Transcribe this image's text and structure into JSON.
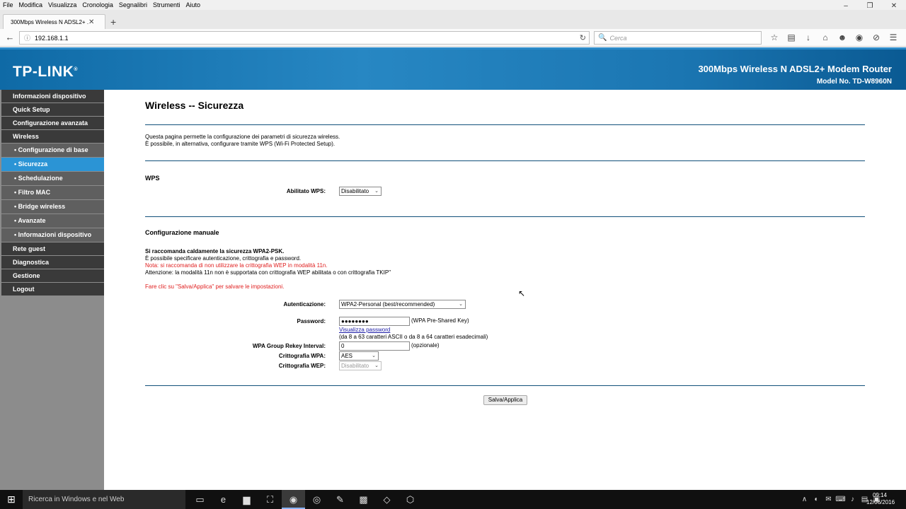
{
  "browser": {
    "menu": [
      "File",
      "Modifica",
      "Visualizza",
      "Cronologia",
      "Segnalibri",
      "Strumenti",
      "Aiuto"
    ],
    "window_controls": [
      "–",
      "❐",
      "✕"
    ],
    "tab_title": "300Mbps Wireless N ADSL2+ ...",
    "tab_close": "✕",
    "new_tab": "+",
    "back": "←",
    "info_icon": "ⓘ",
    "url": "192.168.1.1",
    "reload": "↻",
    "search_placeholder": "Cerca",
    "search_icon": "🔍",
    "toolbar_icons": [
      "☆",
      "▤",
      "↓",
      "⌂",
      "☻",
      "◉",
      "⊘",
      "☰"
    ]
  },
  "router": {
    "logo": "TP-LINK",
    "logo_mark": "®",
    "product": "300Mbps Wireless N ADSL2+ Modem Router",
    "model": "Model No. TD-W8960N",
    "sidebar": [
      {
        "label": "Informazioni dispositivo",
        "sub": false,
        "active": false
      },
      {
        "label": "Quick Setup",
        "sub": false,
        "active": false
      },
      {
        "label": "Configurazione avanzata",
        "sub": false,
        "active": false
      },
      {
        "label": "Wireless",
        "sub": false,
        "active": false
      },
      {
        "label": "• Configurazione di base",
        "sub": true,
        "active": false
      },
      {
        "label": "• Sicurezza",
        "sub": true,
        "active": true
      },
      {
        "label": "• Schedulazione",
        "sub": true,
        "active": false
      },
      {
        "label": "• Filtro MAC",
        "sub": true,
        "active": false
      },
      {
        "label": "• Bridge wireless",
        "sub": true,
        "active": false
      },
      {
        "label": "• Avanzate",
        "sub": true,
        "active": false
      },
      {
        "label": "• Informazioni dispositivo",
        "sub": true,
        "active": false
      },
      {
        "label": "Rete guest",
        "sub": false,
        "active": false
      },
      {
        "label": "Diagnostica",
        "sub": false,
        "active": false
      },
      {
        "label": "Gestione",
        "sub": false,
        "active": false
      },
      {
        "label": "Logout",
        "sub": false,
        "active": false
      }
    ],
    "page_title": "Wireless -- Sicurezza",
    "desc_line1": "Questa pagina permette la configurazione dei parametri di sicurezza wireless.",
    "desc_line2": "È possibile, in alternativa, configurare tramite WPS (Wi-Fi Protected Setup).",
    "wps_heading": "WPS",
    "wps_label": "Abilitato WPS:",
    "wps_value": "Disabilitato",
    "manual_heading": "Configurazione manuale",
    "rec_bold": "Si raccomanda caldamente la sicurezza WPA2-PSK.",
    "rec_line2": "È possibile specificare autenticazione, crittografia e password.",
    "rec_note_red": "Nota: si raccomanda di non utilizzare la crittografia WEP in modalità 11n.",
    "rec_line4": "Attenzione: la modalità 11n non è supportata con crittografia WEP abilitata o con crittografia TKIP\"",
    "save_hint_red": "Fare clic su \"Salva/Applica\" per salvare le impostazioni.",
    "auth_label": "Autenticazione:",
    "auth_value": "WPA2-Personal (best/recommended)",
    "password_label": "Password:",
    "password_value": "●●●●●●●●",
    "password_note": "(WPA Pre-Shared Key)",
    "show_password": "Visualizza password",
    "password_hint": "(da 8 a 63 caratteri ASCII o da 8 a 64 caratteri esadecimali)",
    "rekey_label": "WPA Group Rekey Interval:",
    "rekey_value": "0",
    "rekey_note": "(opzionale)",
    "wpa_enc_label": "Crittografia WPA:",
    "wpa_enc_value": "AES",
    "wep_enc_label": "Crittografia WEP:",
    "wep_enc_value": "Disabilitato",
    "save_button": "Salva/Applica",
    "select_arrow": "⌄"
  },
  "taskbar": {
    "start": "⊞",
    "search_text": "Ricerca in Windows e nel Web",
    "apps": [
      "▭",
      "e",
      "▆",
      "⛶",
      "◉",
      "◎",
      "✎",
      "▩",
      "◇",
      "⬡"
    ],
    "tray": [
      "∧",
      "◐",
      "✉",
      "⌨",
      "♪",
      "▤",
      "▣"
    ],
    "time": "09:14",
    "date": "12/06/2016"
  },
  "colors": {
    "sidebar_active": "#2b94d5",
    "header_blue": "#1b76b2",
    "warning_red": "#e02020"
  }
}
